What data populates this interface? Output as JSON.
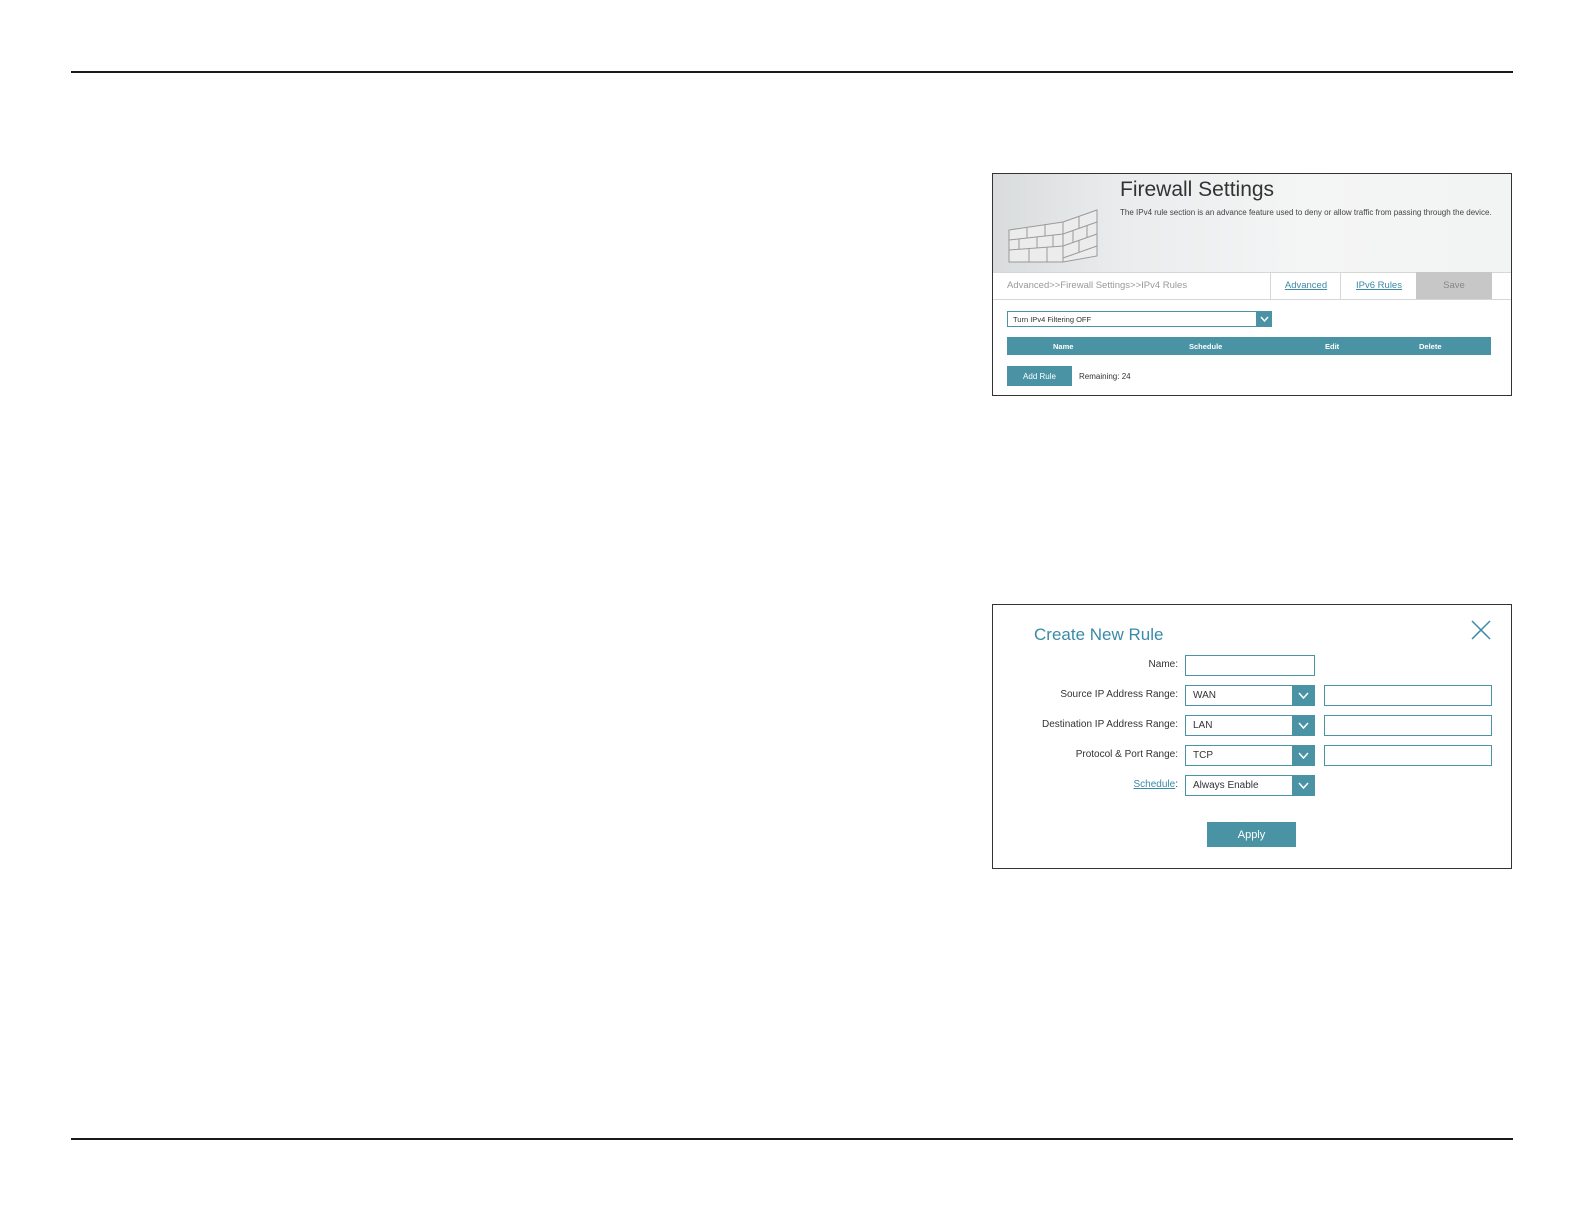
{
  "firewall": {
    "title": "Firewall Settings",
    "description": "The IPv4 rule section is an advance feature used to deny or allow traffic from passing through the device.",
    "breadcrumb": "Advanced>>Firewall Settings>>IPv4 Rules",
    "tabs": {
      "advanced": "Advanced",
      "ipv6_rules": "IPv6 Rules",
      "save": "Save"
    },
    "filter_select": {
      "value": "Turn IPv4 Filtering OFF"
    },
    "table_headers": [
      "Name",
      "Schedule",
      "Edit",
      "Delete"
    ],
    "add_rule": "Add Rule",
    "remaining": "Remaining: 24",
    "icons": {
      "wall": "brick-wall-icon",
      "dropdown": "chevron-down-icon"
    }
  },
  "create_rule": {
    "title": "Create New Rule",
    "close_icon": "close-icon",
    "fields": {
      "name_label": "Name:",
      "source_label": "Source IP Address Range:",
      "source_value": "WAN",
      "destination_label": "Destination IP Address Range:",
      "destination_value": "LAN",
      "protocol_label": "Protocol & Port Range:",
      "protocol_value": "TCP",
      "schedule_label": "Schedule",
      "schedule_colon": ":",
      "schedule_value": "Always Enable"
    },
    "apply": "Apply"
  },
  "colors": {
    "accent": "#4a93a5",
    "link": "#3a8aa8",
    "save_disabled": "#c7c7c7"
  }
}
